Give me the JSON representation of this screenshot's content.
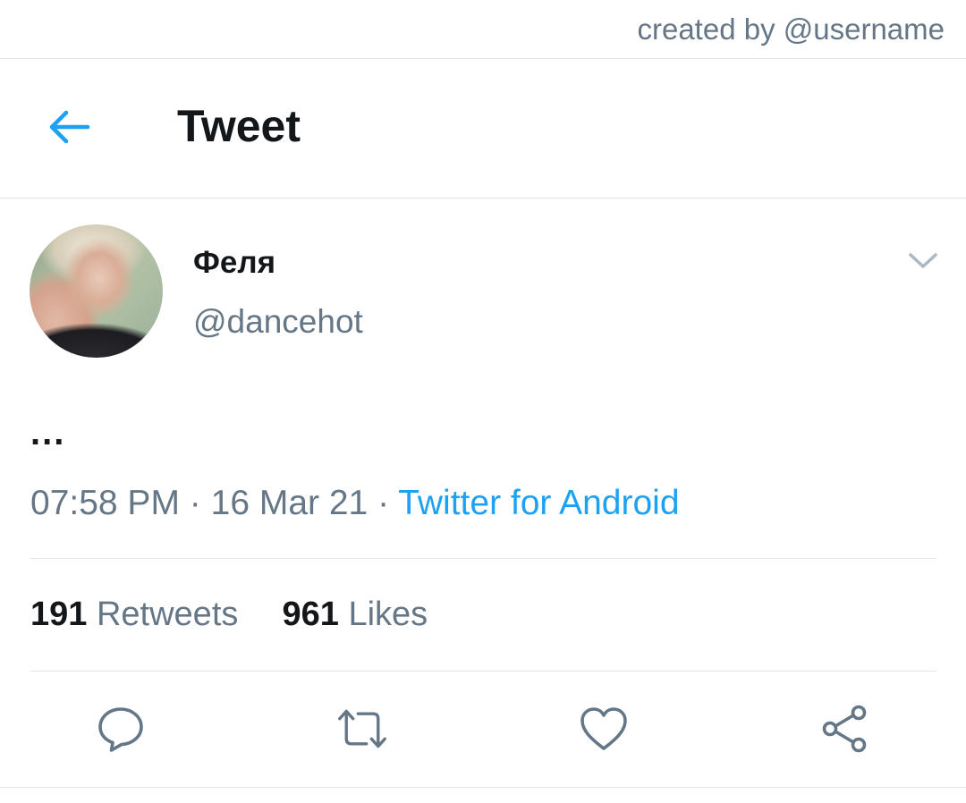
{
  "credit": "created by @username",
  "header": {
    "title": "Tweet"
  },
  "tweet": {
    "author_name": "Феля",
    "author_handle": "@dancehot",
    "text": "...",
    "time": "07:58 PM",
    "separator": "·",
    "date": "16 Mar 21",
    "source": "Twitter for Android"
  },
  "stats": {
    "retweets_count": "191",
    "retweets_label": "Retweets",
    "likes_count": "961",
    "likes_label": "Likes"
  },
  "colors": {
    "accent": "#1da1f2",
    "secondary_text": "#657786",
    "primary_text": "#14171a",
    "divider": "#e1e4e8"
  },
  "icons": {
    "back": "arrow-left-icon",
    "menu": "chevron-down-icon",
    "reply": "reply-icon",
    "retweet": "retweet-icon",
    "like": "heart-icon",
    "share": "share-icon"
  }
}
